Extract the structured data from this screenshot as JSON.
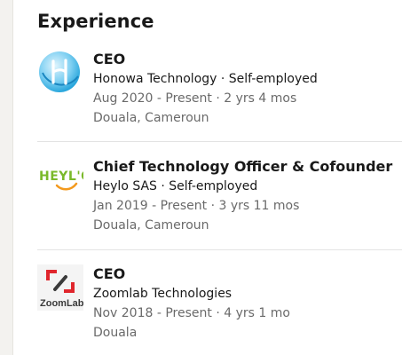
{
  "section": {
    "title": "Experience"
  },
  "experiences": [
    {
      "role": "CEO",
      "company_line": "Honowa Technology · Self-employed",
      "dates": "Aug 2020 - Present · 2 yrs 4 mos",
      "location": "Douala, Cameroun",
      "logo_icon": "honowa-logo-icon"
    },
    {
      "role": "Chief Technology Officer & Cofounder",
      "company_line": "Heylo SAS · Self-employed",
      "dates": "Jan 2019 - Present · 3 yrs 11 mos",
      "location": "Douala, Cameroun",
      "logo_icon": "heylo-logo-icon",
      "logo_text": "HEYL'O"
    },
    {
      "role": "CEO",
      "company_line": "Zoomlab Technologies",
      "dates": "Nov 2018 - Present · 4 yrs 1 mo",
      "location": "Douala",
      "logo_icon": "zoomlab-logo-icon",
      "logo_text": "ZoomLab"
    }
  ],
  "colors": {
    "honowa_blue": "#1aa3dc",
    "heylo_green": "#7ab92a",
    "heylo_orange": "#f39a1e",
    "zoomlab_red": "#e0262d",
    "zoomlab_dark": "#3a3a3a"
  }
}
